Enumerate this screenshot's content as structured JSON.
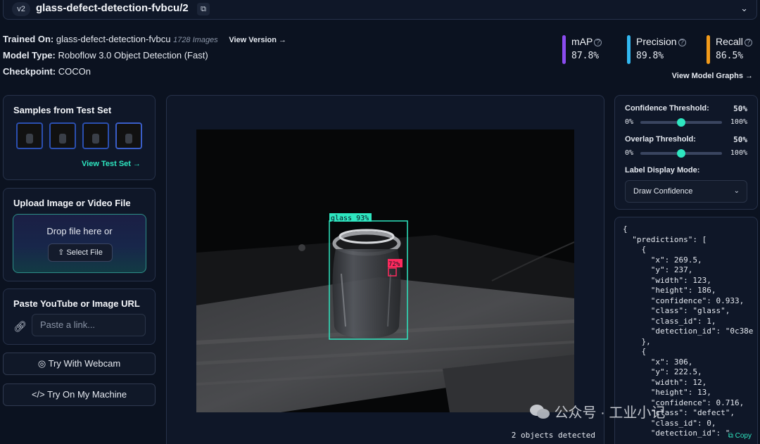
{
  "version": {
    "badge": "v2",
    "title": "glass-defect-detection-fvbcu/2"
  },
  "model": {
    "trained_on_label": "Trained On:",
    "trained_on_value": "glass-defect-detection-fvbcu",
    "image_count": "1728 Images",
    "view_version": "View Version →",
    "type_label": "Model Type:",
    "type_value": "Roboflow 3.0 Object Detection (Fast)",
    "checkpoint_label": "Checkpoint:",
    "checkpoint_value": "COCOn"
  },
  "metrics": [
    {
      "name": "mAP",
      "value": "87.8%",
      "color": "#8b4cf0"
    },
    {
      "name": "Precision",
      "value": "89.8%",
      "color": "#32b8f0"
    },
    {
      "name": "Recall",
      "value": "86.5%",
      "color": "#f29a1a"
    }
  ],
  "view_graphs": "View Model Graphs →",
  "samples": {
    "title": "Samples from Test Set",
    "link": "View Test Set →"
  },
  "upload": {
    "title": "Upload Image or Video File",
    "drop_text": "Drop file here or",
    "select_button": "Select File"
  },
  "url": {
    "title": "Paste YouTube or Image URL",
    "placeholder": "Paste a link..."
  },
  "webcam_button": "Try With Webcam",
  "machine_button": "Try On My Machine",
  "detections": [
    {
      "label": "glass 93%",
      "color": "#2ee6c0"
    },
    {
      "label": "72%",
      "color": "#ff2a5e"
    }
  ],
  "objects_detected": "2 objects detected",
  "settings": {
    "confidence_label": "Confidence Threshold:",
    "confidence_value": "50%",
    "confidence_fraction": 0.5,
    "overlap_label": "Overlap Threshold:",
    "overlap_value": "50%",
    "overlap_fraction": 0.5,
    "min": "0%",
    "max": "100%",
    "label_mode_label": "Label Display Mode:",
    "label_mode_value": "Draw Confidence"
  },
  "json_output": "{\n  \"predictions\": [\n    {\n      \"x\": 269.5,\n      \"y\": 237,\n      \"width\": 123,\n      \"height\": 186,\n      \"confidence\": 0.933,\n      \"class\": \"glass\",\n      \"class_id\": 1,\n      \"detection_id\": \"0c38e\n    },\n    {\n      \"x\": 306,\n      \"y\": 222.5,\n      \"width\": 12,\n      \"height\": 13,\n      \"confidence\": 0.716,\n      \"class\": \"defect\",\n      \"class_id\": 0,\n      \"detection_id\": \"",
  "copy_label": "Copy",
  "watermark": "公众号 · 工业小记"
}
